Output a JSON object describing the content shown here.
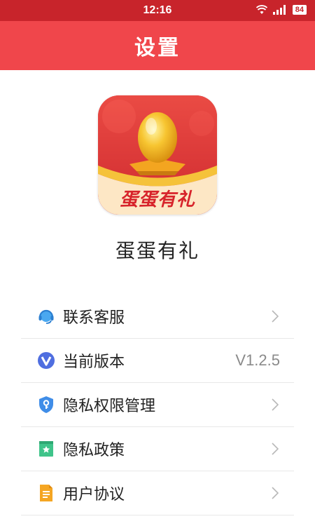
{
  "status_bar": {
    "time": "12:16",
    "battery": "84"
  },
  "header": {
    "title": "设置"
  },
  "app": {
    "icon_text": "蛋蛋有礼",
    "name": "蛋蛋有礼"
  },
  "menu": [
    {
      "label": "联系客服",
      "icon": "customer-service-icon",
      "value": ""
    },
    {
      "label": "当前版本",
      "icon": "version-icon",
      "value": "V1.2.5"
    },
    {
      "label": "隐私权限管理",
      "icon": "shield-key-icon",
      "value": ""
    },
    {
      "label": "隐私政策",
      "icon": "bookmark-star-icon",
      "value": ""
    },
    {
      "label": "用户协议",
      "icon": "document-icon",
      "value": ""
    }
  ],
  "colors": {
    "status_bar": "#c8242b",
    "header": "#f0464b",
    "divider": "#e8e8e8"
  }
}
